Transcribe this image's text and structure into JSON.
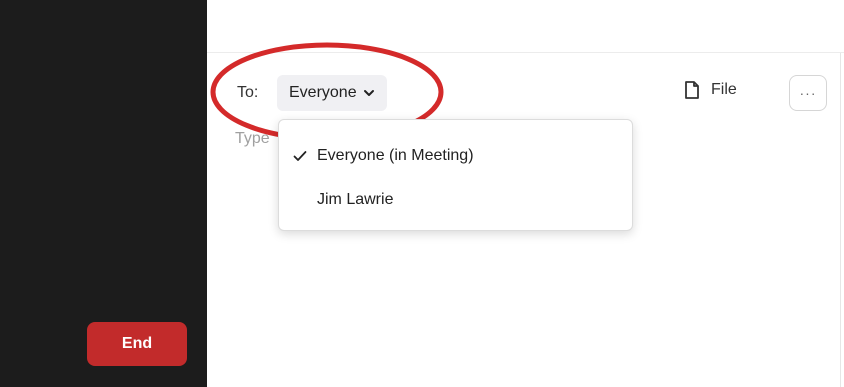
{
  "sidebar": {
    "end_label": "End"
  },
  "chat": {
    "to_label": "To:",
    "recipient_selected": "Everyone",
    "file_label": "File",
    "more_label": "···",
    "placeholder_visible": "Type"
  },
  "dropdown": {
    "items": [
      {
        "label": "Everyone (in Meeting)",
        "checked": true
      },
      {
        "label": "Jim Lawrie",
        "checked": false
      }
    ]
  },
  "colors": {
    "end_button": "#c22b2b",
    "highlight_ellipse": "#d42a2a",
    "left_panel": "#1c1c1c"
  },
  "icons": {
    "chevron": "chevron-down-icon",
    "file": "file-icon",
    "check": "check-icon"
  }
}
